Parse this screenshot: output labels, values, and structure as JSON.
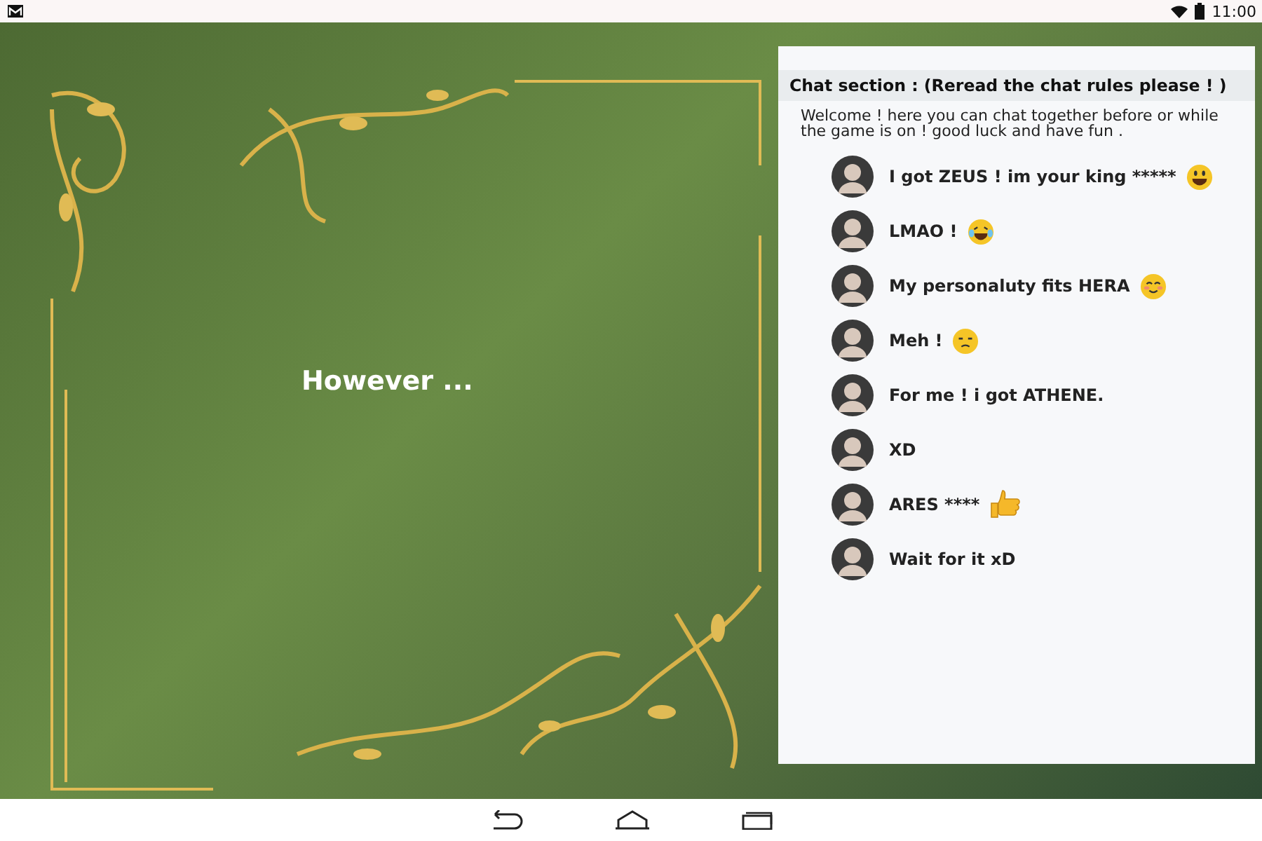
{
  "status_bar": {
    "time": "11:00"
  },
  "scene": {
    "caption": "However ..."
  },
  "chat": {
    "title": "Chat section : (Reread the chat rules please ! )",
    "intro": "Welcome ! here you can chat together before or while the game is on ! good luck and have fun .",
    "messages": [
      {
        "text": "I got ZEUS ! im your king *****",
        "kind": "grin"
      },
      {
        "text": "LMAO !",
        "kind": "tears"
      },
      {
        "text": "My personaluty fits HERA",
        "kind": "blush"
      },
      {
        "text": "Meh !",
        "kind": "unamused"
      },
      {
        "text": "For me ! i got ATHENE.",
        "kind": "plain"
      },
      {
        "text": "XD",
        "kind": "plain"
      },
      {
        "text": "ARES ****",
        "kind": "thumbs"
      },
      {
        "text": "Wait for it xD",
        "kind": "plain"
      }
    ]
  }
}
